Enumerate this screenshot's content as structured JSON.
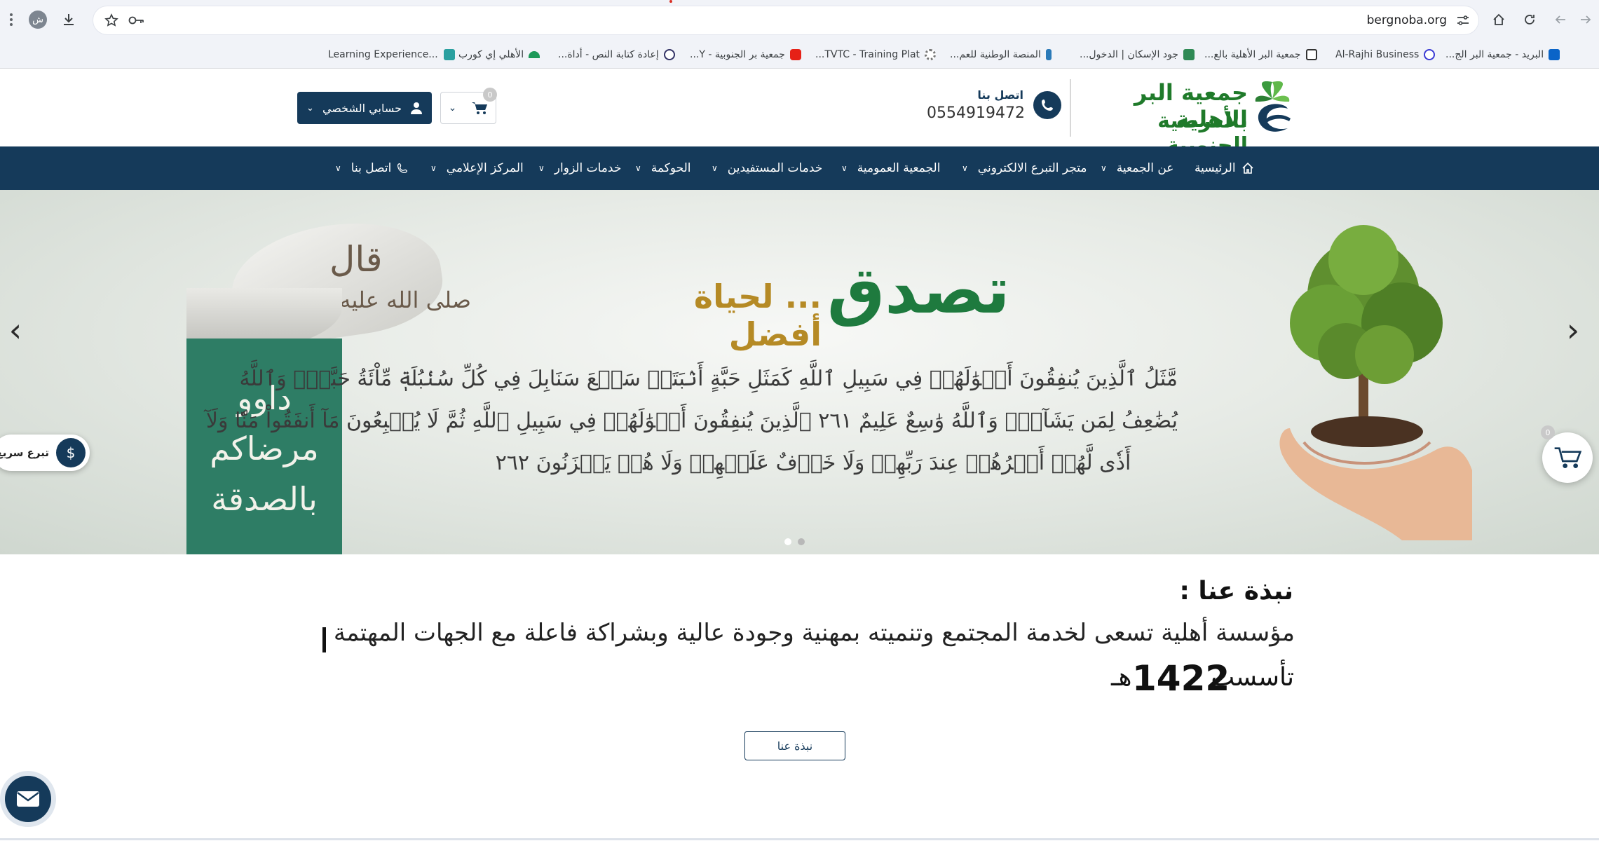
{
  "browser": {
    "url": "bergnoba.org",
    "profile_initial": "ش"
  },
  "bookmarks": [
    {
      "label": "البريد - جمعية البر الج...",
      "icon": "outlook-icon",
      "color": "#0a64c8"
    },
    {
      "label": "Al-Rajhi Business",
      "icon": "alrajhi-icon",
      "color": "#3b3bd4"
    },
    {
      "label": "جمعية البر الأهلية بالع...",
      "icon": "bookmark-site-icon",
      "color": "#333333"
    },
    {
      "label": "جود الإسكان | الدخول...",
      "icon": "jood-icon",
      "color": "#2f8a55"
    },
    {
      "label": "المنصة الوطنية للعم...",
      "icon": "national-platform-icon",
      "color": "#2b7ab8"
    },
    {
      "label": "TVTC - Training Plat...",
      "icon": "gear-icon",
      "color": "#777777"
    },
    {
      "label": "جمعية بر الجنوبية - Y...",
      "icon": "youtube-icon",
      "color": "#e62117"
    },
    {
      "label": "إعادة كتابة النص - أداة...",
      "icon": "rewrite-tool-icon",
      "color": "#333366"
    },
    {
      "label": "الأهلي إي كورب",
      "icon": "alahli-icon",
      "color": "#1e9a5a"
    },
    {
      "label": "Learning Experience...",
      "icon": "learning-icon",
      "color": "#2aa0a0"
    }
  ],
  "header": {
    "logo_line1": "جمعية البر الأهلية",
    "logo_line2": "بالعرضية الجنوبية",
    "contact_label": "اتصل بنا",
    "contact_phone": "0554919472",
    "account_label": "حسابي الشخصي",
    "cart_count": "0"
  },
  "nav": [
    {
      "label": "الرئيسية",
      "icon": "home-icon"
    },
    {
      "label": "عن الجمعية",
      "dropdown": true
    },
    {
      "label": "متجر التبرع الالكتروني",
      "dropdown": true
    },
    {
      "label": "الجمعية العمومية",
      "dropdown": true
    },
    {
      "label": "خدمات المستفيدين",
      "dropdown": true
    },
    {
      "label": "الحوكمة",
      "dropdown": true
    },
    {
      "label": "خدمات الزوار",
      "dropdown": true
    },
    {
      "label": "المركز الإعلامي",
      "dropdown": true
    },
    {
      "label": "اتصل بنا",
      "icon": "phone-icon",
      "dropdown": true
    }
  ],
  "hero": {
    "title": "تصدق",
    "subtitle": "... لحياة أفضل",
    "verse_lines": [
      "مَّثَلُ ٱلَّذِينَ يُنفِقُونَ أَمۡوَٰلَهُمۡ فِي سَبِيلِ ٱللَّهِ كَمَثَلِ حَبَّةٍ أَنۢبَتَتۡ سَبۡعَ سَنَابِلَ فِي كُلِّ سُنۢبُلَةٖ مِّاْئَةُ حَبَّةٖۗ وَٱللَّهُ",
      "يُضَٰعِفُ لِمَن يَشَآءُۚ وَٱللَّهُ وَٰسِعٌ عَلِيمٌ ٢٦١ ٱلَّذِينَ يُنفِقُونَ أَمۡوَٰلَهُمۡ فِي سَبِيلِ ٱللَّهِ ثُمَّ لَا يُتۡبِعُونَ مَآ أَنفَقُواْ مَنّٗا وَلَآ",
      "أَذٗى لَّهُمۡ أَجۡرُهُمۡ عِندَ رَبِّهِمۡ وَلَا خَوۡفٌ عَلَيۡهِمۡ وَلَا هُمۡ يَحۡزَنُونَ ٢٦٢"
    ],
    "scroll_heading": "قال",
    "scroll_sub": "صلى الله عليه وسلم",
    "panel_lines": [
      "داوو",
      "مرضاكم",
      "بالصدقة"
    ],
    "slide_count": 2,
    "active_slide": 1,
    "quick_donate_label": "تبرع سريع",
    "float_cart_count": "0"
  },
  "about": {
    "title": "نبذة عنا :",
    "description": "مؤسسة أهلية تسعى لخدمة المجتمع وتنميته بمهنية وجودة عالية وبشراكة فاعلة مع الجهات المهتمة",
    "founded_label": "تأسست",
    "founded_year": "1422",
    "founded_suffix": "هـ",
    "button_label": "نبذة عنا"
  }
}
